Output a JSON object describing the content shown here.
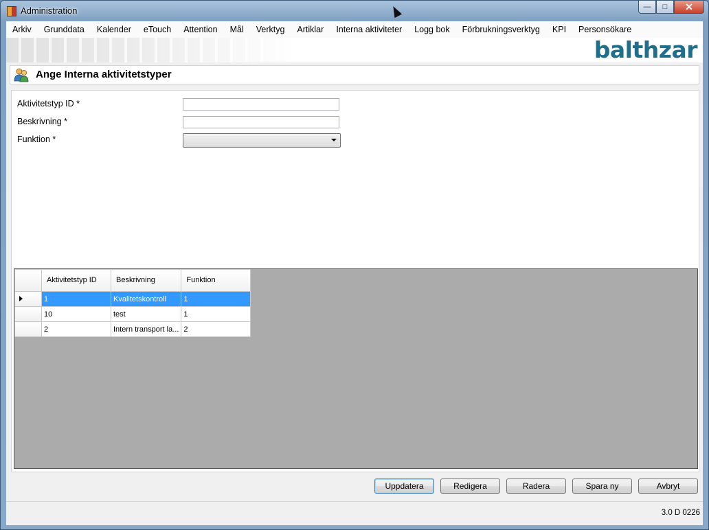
{
  "window": {
    "title": "Administration",
    "buttons": {
      "minimize": "—",
      "maximize": "□",
      "close": "✕"
    }
  },
  "menu": [
    "Arkiv",
    "Grunddata",
    "Kalender",
    "eTouch",
    "Attention",
    "Mål",
    "Verktyg",
    "Artiklar",
    "Interna aktiviteter",
    "Logg bok",
    "Förbrukningsverktyg",
    "KPI",
    "Personsökare"
  ],
  "logo": "balthzar",
  "header": {
    "icon": "users-icon",
    "title": "Ange Interna aktivitetstyper"
  },
  "form": {
    "id_label": "Aktivitetstyp ID *",
    "id_value": "",
    "desc_label": "Beskrivning *",
    "desc_value": "",
    "func_label": "Funktion *",
    "func_value": ""
  },
  "grid": {
    "columns": [
      "Aktivitetstyp ID",
      "Beskrivning",
      "Funktion"
    ],
    "rows": [
      {
        "id": "1",
        "desc": "Kvalitetskontroll",
        "func": "1",
        "selected": true
      },
      {
        "id": "10",
        "desc": "test",
        "func": "1",
        "selected": false
      },
      {
        "id": "2",
        "desc": "Intern transport la...",
        "func": "2",
        "selected": false
      }
    ],
    "selection_color": "#3399ff"
  },
  "buttons": {
    "update": "Uppdatera",
    "edit": "Redigera",
    "delete": "Radera",
    "save_new": "Spara ny",
    "cancel": "Avbryt"
  },
  "status": {
    "version": "3.0 D 0226"
  }
}
